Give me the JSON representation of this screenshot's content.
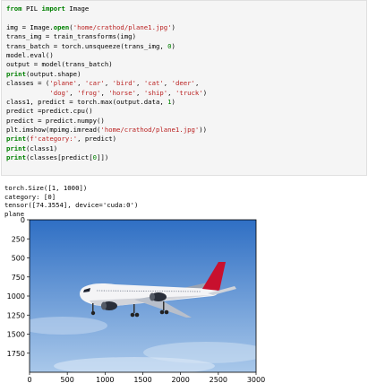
{
  "code_cell": {
    "lines": [
      [
        {
          "t": "from",
          "c": "kw"
        },
        {
          "t": " PIL "
        },
        {
          "t": "import",
          "c": "kw"
        },
        {
          "t": " Image"
        }
      ],
      [],
      [
        {
          "t": "img = Image."
        },
        {
          "t": "open",
          "c": "kw"
        },
        {
          "t": "("
        },
        {
          "t": "'home/crathod/plane1.jpg'",
          "c": "str"
        },
        {
          "t": ")"
        }
      ],
      [
        {
          "t": "trans_img = train_transforms(img)"
        }
      ],
      [
        {
          "t": "trans_batch = torch.unsqueeze(trans_img, "
        },
        {
          "t": "0",
          "c": "num"
        },
        {
          "t": ")"
        }
      ],
      [
        {
          "t": "model.eval()"
        }
      ],
      [
        {
          "t": "output = model(trans_batch)"
        }
      ],
      [
        {
          "t": "print",
          "c": "kw"
        },
        {
          "t": "(output.shape)"
        }
      ],
      [
        {
          "t": "classes = ("
        },
        {
          "t": "'plane'",
          "c": "str"
        },
        {
          "t": ", "
        },
        {
          "t": "'car'",
          "c": "str"
        },
        {
          "t": ", "
        },
        {
          "t": "'bird'",
          "c": "str"
        },
        {
          "t": ", "
        },
        {
          "t": "'cat'",
          "c": "str"
        },
        {
          "t": ", "
        },
        {
          "t": "'deer'",
          "c": "str"
        },
        {
          "t": ","
        }
      ],
      [
        {
          "t": "           "
        },
        {
          "t": "'dog'",
          "c": "str"
        },
        {
          "t": ", "
        },
        {
          "t": "'frog'",
          "c": "str"
        },
        {
          "t": ", "
        },
        {
          "t": "'horse'",
          "c": "str"
        },
        {
          "t": ", "
        },
        {
          "t": "'ship'",
          "c": "str"
        },
        {
          "t": ", "
        },
        {
          "t": "'truck'",
          "c": "str"
        },
        {
          "t": ")"
        }
      ],
      [
        {
          "t": "class1, predict = torch.max(output.data, "
        },
        {
          "t": "1",
          "c": "num"
        },
        {
          "t": ")"
        }
      ],
      [
        {
          "t": "predict =predict.cpu()"
        }
      ],
      [
        {
          "t": "predict = predict.numpy()"
        }
      ],
      [
        {
          "t": "plt.imshow(mpimg.imread("
        },
        {
          "t": "'home/crathod/plane1.jpg'",
          "c": "str"
        },
        {
          "t": "))"
        }
      ],
      [
        {
          "t": "print",
          "c": "kw"
        },
        {
          "t": "("
        },
        {
          "t": "f'category:'",
          "c": "str"
        },
        {
          "t": ", predict)"
        }
      ],
      [
        {
          "t": "print",
          "c": "kw"
        },
        {
          "t": "(class1)"
        }
      ],
      [
        {
          "t": "print",
          "c": "kw"
        },
        {
          "t": "(classes[predict["
        },
        {
          "t": "0",
          "c": "num"
        },
        {
          "t": "]])"
        }
      ]
    ]
  },
  "output_cell": {
    "stdout": [
      "torch.Size([1, 1000])",
      "category: [0]",
      "tensor([74.3554], device='cuda:0')",
      "plane"
    ]
  },
  "image_plot": {
    "x_ticks": [
      0,
      500,
      1000,
      1500,
      2000,
      2500,
      3000
    ],
    "y_ticks": [
      0,
      250,
      500,
      750,
      1000,
      1250,
      1500,
      1750
    ],
    "x_range": [
      0,
      3000
    ],
    "y_range": [
      0,
      2000
    ],
    "colors": {
      "sky_top": "#2f6fc4",
      "sky_bottom": "#a9c8ea",
      "fuselage": "#f4f4f6",
      "tail": "#c8102e",
      "engine": "#2a2f3a"
    }
  }
}
